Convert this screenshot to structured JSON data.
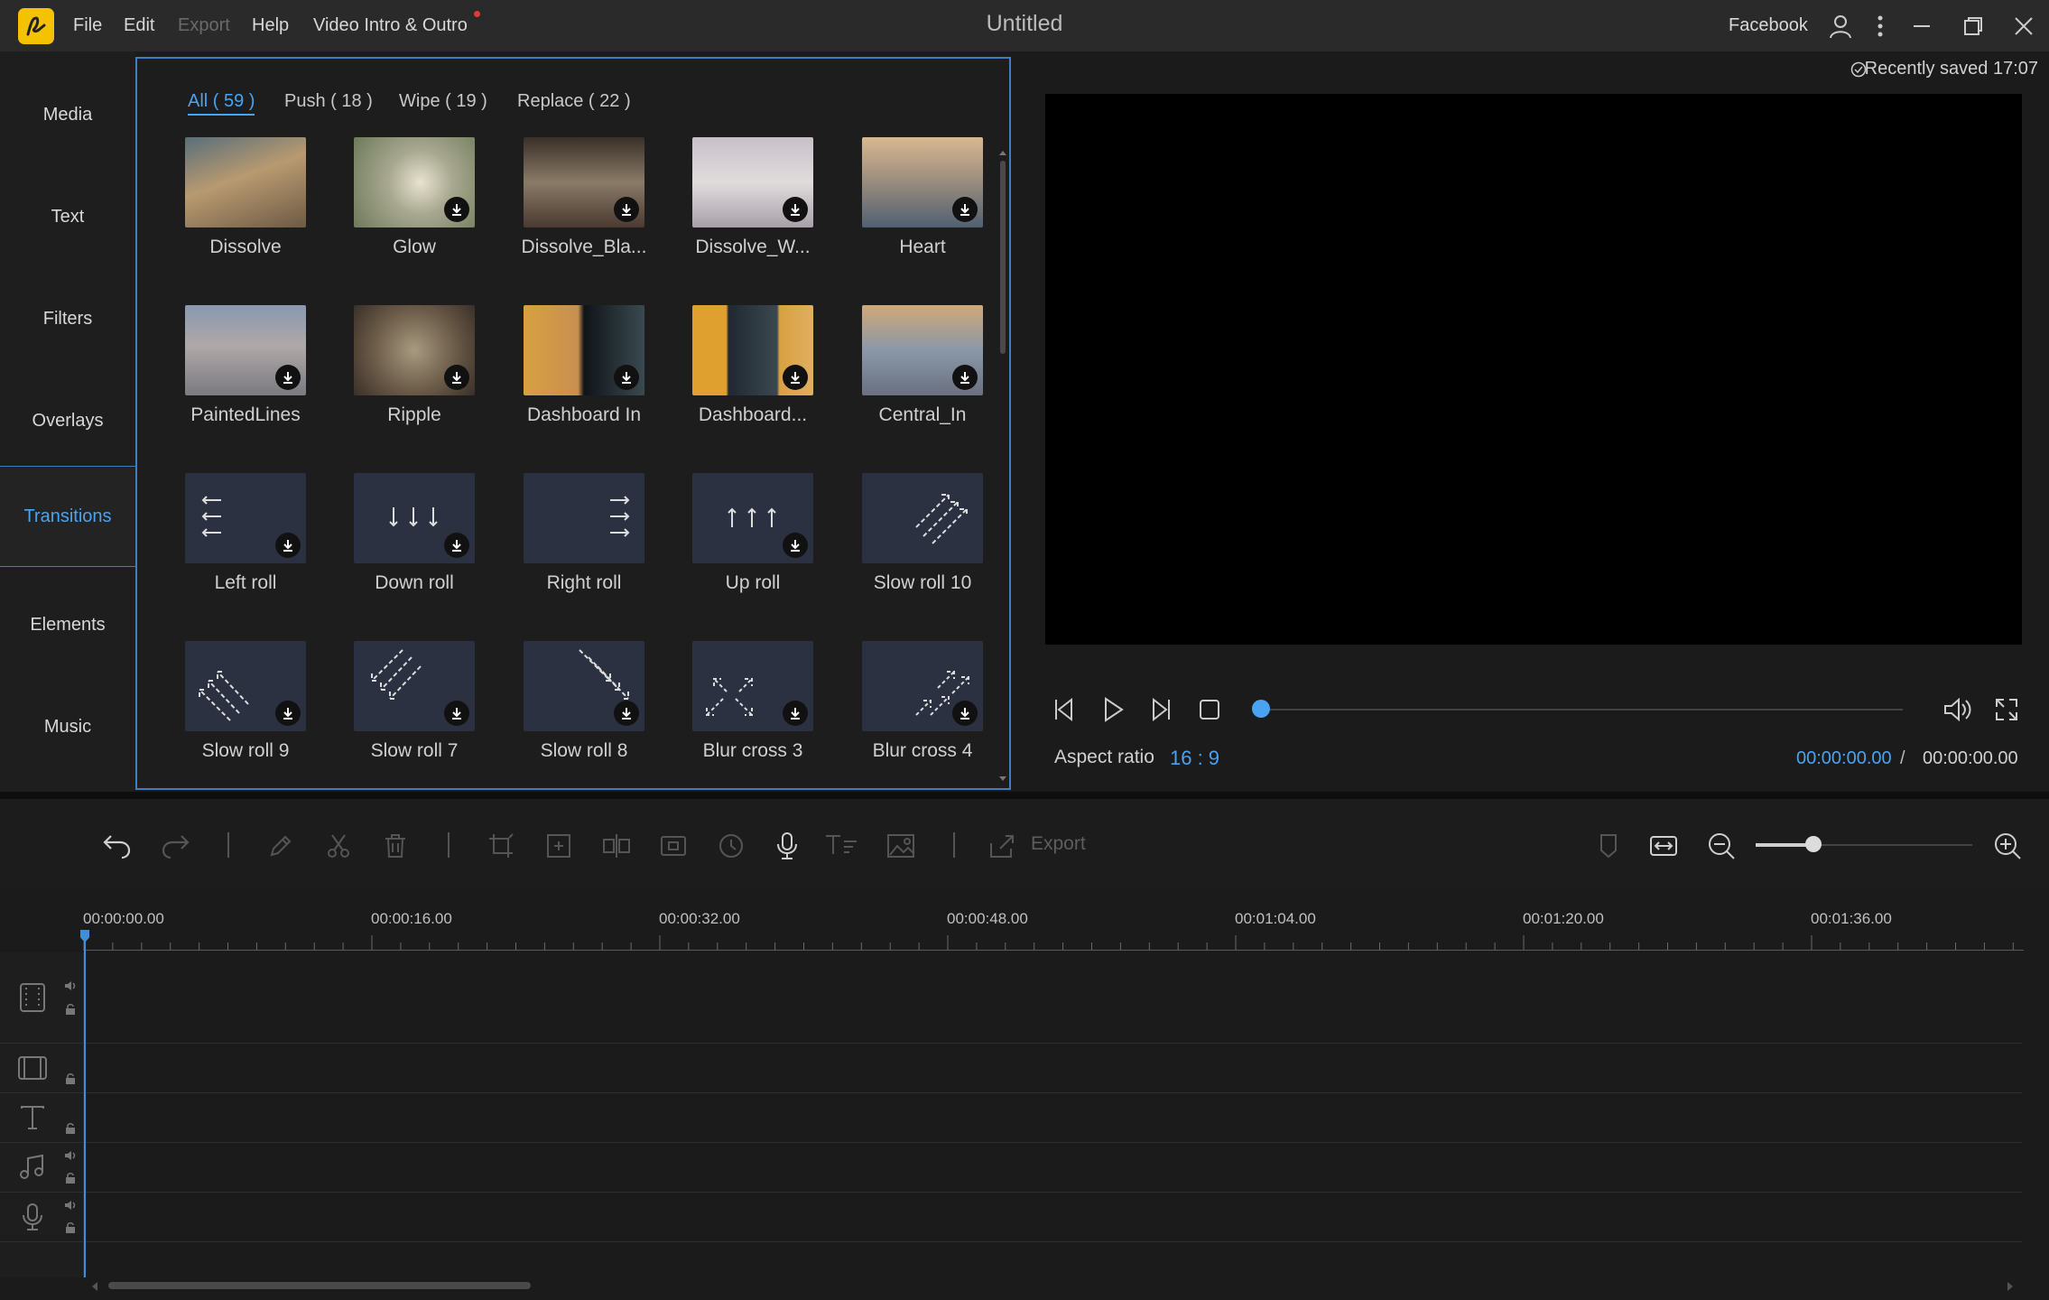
{
  "titlebar": {
    "title": "Untitled",
    "menus": [
      "File",
      "Edit",
      "Export",
      "Help",
      "Video Intro & Outro"
    ],
    "account": "Facebook"
  },
  "nav": {
    "items": [
      "Media",
      "Text",
      "Filters",
      "Overlays",
      "Transitions",
      "Elements",
      "Music"
    ],
    "active": "Transitions"
  },
  "library": {
    "tabs": [
      "All ( 59 )",
      "Push ( 18 )",
      "Wipe ( 19 )",
      "Replace ( 22 )"
    ],
    "items": [
      "Dissolve",
      "Glow",
      "Dissolve_Bla...",
      "Dissolve_W...",
      "Heart",
      "PaintedLines",
      "Ripple",
      "Dashboard In",
      "Dashboard...",
      "Central_In",
      "Left roll",
      "Down roll",
      "Right roll",
      "Up roll",
      "Slow roll 10",
      "Slow roll 9",
      "Slow roll 7",
      "Slow roll 8",
      "Blur cross 3",
      "Blur cross 4"
    ]
  },
  "preview": {
    "saved": "Recently saved 17:07",
    "aspect_label": "Aspect ratio",
    "aspect_value": "16 : 9",
    "time_current": "00:00:00.00",
    "time_separator": "/",
    "time_total": "00:00:00.00"
  },
  "timeline": {
    "export_label": "Export",
    "ticks": [
      "00:00:00.00",
      "00:00:16.00",
      "00:00:32.00",
      "00:00:48.00",
      "00:01:04.00",
      "00:01:20.00",
      "00:01:36.00"
    ]
  },
  "colors": {
    "accent": "#4aa3f0",
    "logo": "#f5c200",
    "notify": "#e53935"
  }
}
